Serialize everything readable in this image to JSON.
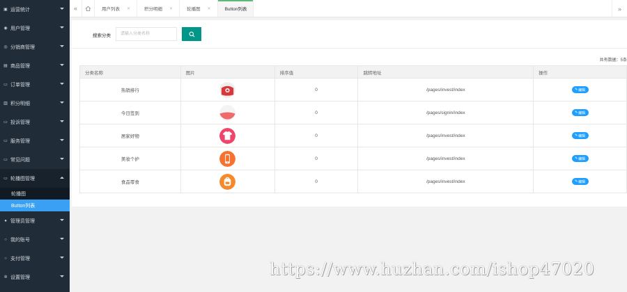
{
  "sidebar": {
    "items": [
      {
        "label": "运营统计",
        "icon": "chart-icon"
      },
      {
        "label": "用户管理",
        "icon": "user-icon"
      },
      {
        "label": "分销商管理",
        "icon": "distributor-icon"
      },
      {
        "label": "商品管理",
        "icon": "product-icon"
      },
      {
        "label": "订单管理",
        "icon": "order-icon"
      },
      {
        "label": "积分明细",
        "icon": "points-icon"
      },
      {
        "label": "投诉管理",
        "icon": "complaint-icon"
      },
      {
        "label": "服务管理",
        "icon": "service-icon"
      },
      {
        "label": "常见问题",
        "icon": "faq-icon"
      },
      {
        "label": "轮播图管理",
        "icon": "banner-icon"
      }
    ],
    "submenu": [
      {
        "label": "轮播图"
      },
      {
        "label": "Button列表"
      }
    ],
    "items_after": [
      {
        "label": "管理员管理",
        "icon": "admin-icon"
      },
      {
        "label": "我的账号",
        "icon": "account-icon"
      },
      {
        "label": "支付管理",
        "icon": "payment-icon"
      },
      {
        "label": "设置管理",
        "icon": "settings-icon"
      }
    ]
  },
  "tabs": [
    {
      "label": "用户列表"
    },
    {
      "label": "积分明细"
    },
    {
      "label": "轮播图"
    },
    {
      "label": "Button列表"
    }
  ],
  "search": {
    "label": "搜索分类",
    "placeholder": "请输入分类名称"
  },
  "total_label": "共有数据：5条",
  "table": {
    "headers": [
      "分类名称",
      "图片",
      "排序值",
      "跳转地址",
      "操作"
    ],
    "rows": [
      {
        "name": "热销排行",
        "sort": "0",
        "url": "/pages/invest/index",
        "action": "编辑",
        "thumb_color": "#d9383a"
      },
      {
        "name": "今日签到",
        "sort": "0",
        "url": "/pages/signin/index",
        "action": "编辑",
        "thumb_color": "#ef6b6b"
      },
      {
        "name": "居家好物",
        "sort": "0",
        "url": "/pages/invest/index",
        "action": "编辑",
        "thumb_color": "#f0446a"
      },
      {
        "name": "美妆个护",
        "sort": "0",
        "url": "/pages/invest/index",
        "action": "编辑",
        "thumb_color": "#f7722f"
      },
      {
        "name": "食品零食",
        "sort": "0",
        "url": "/pages/invest/index",
        "action": "编辑",
        "thumb_color": "#f58a2c"
      }
    ]
  },
  "watermark": "https://www.huzhan.com/ishop47020",
  "colors": {
    "sidebar_bg": "#202c37",
    "active_sub": "#3aa0f3",
    "search_button": "#009688",
    "edit_button": "#1e9fff",
    "active_tab_indicator": "#5fb878"
  }
}
